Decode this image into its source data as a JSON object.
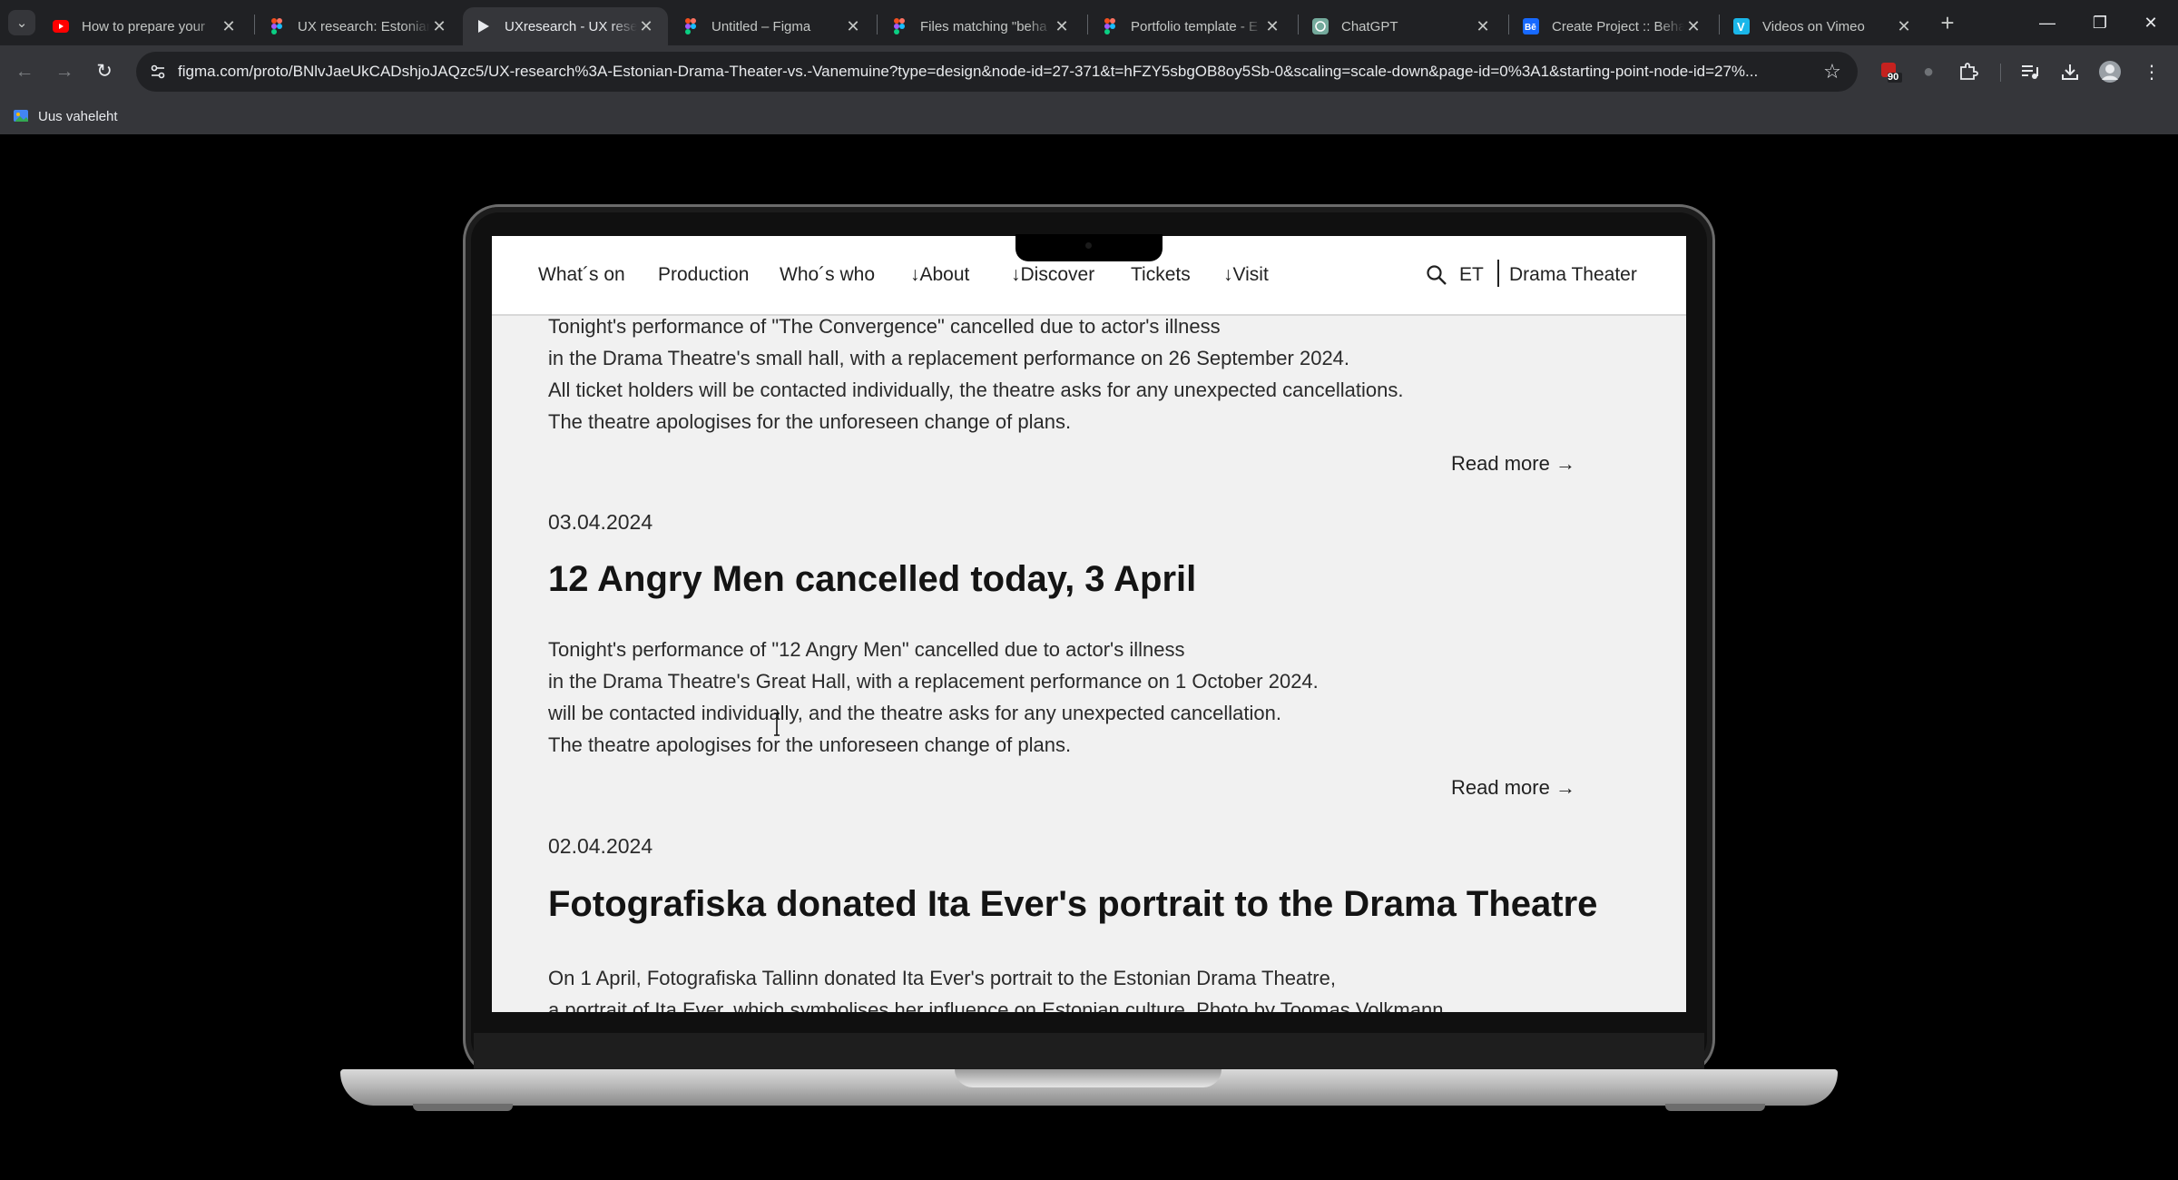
{
  "browser": {
    "tabs": [
      {
        "title": "How to prepare your",
        "icon": "youtube-icon",
        "color": "#ff0000",
        "active": false
      },
      {
        "title": "UX research: Estonian",
        "icon": "figma-icon",
        "color": "#f24e1e",
        "active": false
      },
      {
        "title": "UXresearch - UX rese",
        "icon": "play-icon",
        "color": "#e8eaed",
        "active": true
      },
      {
        "title": "Untitled – Figma",
        "icon": "figma-icon",
        "color": "#f24e1e",
        "active": false
      },
      {
        "title": "Files matching \"beha",
        "icon": "figma-icon",
        "color": "#f24e1e",
        "active": false
      },
      {
        "title": "Portfolio template - E",
        "icon": "figma-icon",
        "color": "#f24e1e",
        "active": false
      },
      {
        "title": "ChatGPT",
        "icon": "chatgpt-icon",
        "color": "#74aa9c",
        "active": false
      },
      {
        "title": "Create Project :: Beha",
        "icon": "behance-icon",
        "color": "#1769ff",
        "active": false
      },
      {
        "title": "Videos on Vimeo",
        "icon": "vimeo-icon",
        "color": "#1ab7ea",
        "active": false
      }
    ],
    "url": "figma.com/proto/BNlvJaeUkCADshjoJAQzc5/UX-research%3A-Estonian-Drama-Theater-vs.-Vanemuine?type=design&node-id=27-371&t=hFZY5sbgOB8oy5Sb-0&scaling=scale-down&page-id=0%3A1&starting-point-node-id=27%...",
    "extension_badge": "90",
    "bookmark": {
      "label": "Uus vaheleht"
    }
  },
  "site": {
    "nav": {
      "whats_on": "What´s on",
      "production": "Production",
      "whos_who": "Who´s who",
      "about": "↓About",
      "discover": "↓Discover",
      "tickets": "Tickets",
      "visit": "↓Visit",
      "language": "ET",
      "brand": "Drama Theater"
    },
    "news": [
      {
        "date": "",
        "title": "",
        "body": [
          "Tonight's performance of \"The Convergence\" cancelled due to actor's illness",
          "in the Drama Theatre's small hall, with a replacement performance on 26 September 2024.",
          "All ticket holders will be contacted individually, the theatre asks for any unexpected cancellations.",
          "The theatre apologises for the unforeseen change of plans."
        ],
        "read_more": "Read more →"
      },
      {
        "date": "03.04.2024",
        "title": "12 Angry Men cancelled today, 3 April",
        "body": [
          "Tonight's performance of \"12 Angry Men\" cancelled due to actor's illness",
          "in the Drama Theatre's Great Hall, with a replacement performance on 1 October 2024.",
          "will be contacted individually, and the theatre asks for any unexpected cancellation.",
          "The theatre apologises for the unforeseen change of plans."
        ],
        "read_more": "Read more →"
      },
      {
        "date": "02.04.2024",
        "title": "Fotografiska donated Ita Ever's portrait to the Drama Theatre",
        "body": [
          "On 1 April, Fotografiska Tallinn donated Ita Ever's portrait to the Estonian Drama Theatre,",
          "a portrait of Ita Ever, which symbolises her influence on Estonian culture. Photo by Toomas Volkmann"
        ],
        "read_more": ""
      }
    ]
  }
}
